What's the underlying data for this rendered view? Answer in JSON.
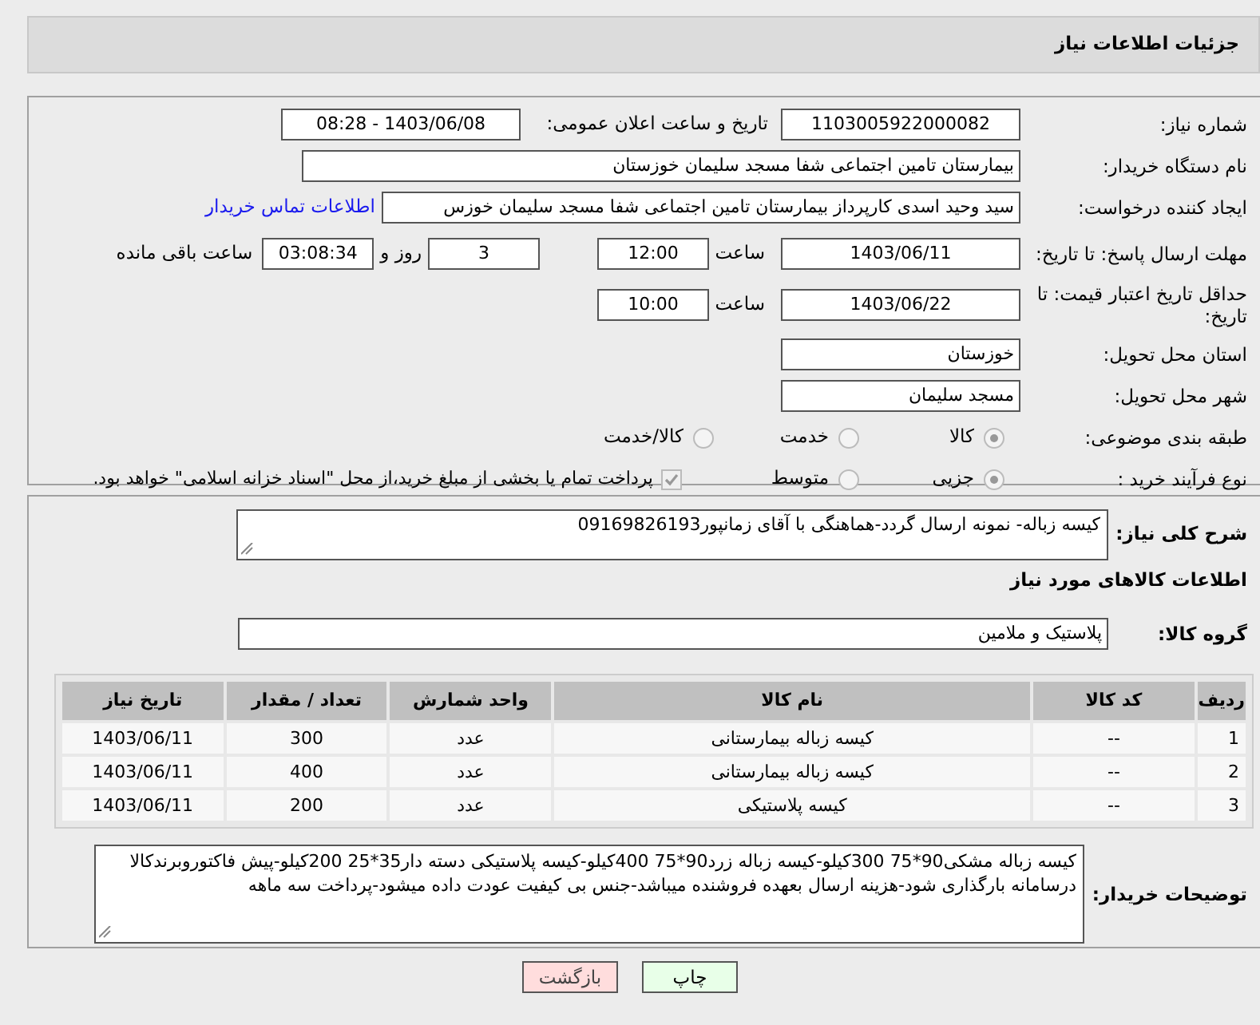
{
  "header": {
    "title": "جزئیات اطلاعات نیاز"
  },
  "need_number": {
    "label": "شماره نیاز:",
    "value": "1103005922000082"
  },
  "announce": {
    "label": "تاریخ و ساعت اعلان عمومی:",
    "value": "1403/06/08 - 08:28"
  },
  "buyer_org": {
    "label": "نام دستگاه خریدار:",
    "value": "بیمارستان تامین اجتماعی شفا مسجد سلیمان خوزستان"
  },
  "requester": {
    "label": "ایجاد کننده درخواست:",
    "value": "سید وحید اسدی کارپرداز بیمارستان تامین اجتماعی شفا مسجد سلیمان خوزس",
    "link": "اطلاعات تماس خریدار"
  },
  "reply_deadline": {
    "label": "مهلت ارسال پاسخ: تا تاریخ:",
    "date": "1403/06/11",
    "time_label": "ساعت",
    "time": "12:00",
    "days": "3",
    "days_label": "روز و",
    "remaining": "03:08:34",
    "remaining_label": "ساعت باقی مانده"
  },
  "price_validity": {
    "label": "حداقل تاریخ اعتبار قیمت: تا تاریخ:",
    "date": "1403/06/22",
    "time_label": "ساعت",
    "time": "10:00"
  },
  "province": {
    "label": "استان محل تحویل:",
    "value": "خوزستان"
  },
  "city": {
    "label": "شهر محل تحویل:",
    "value": "مسجد سلیمان"
  },
  "category": {
    "label": "طبقه بندی موضوعی:",
    "options": [
      {
        "label": "کالا",
        "selected": true
      },
      {
        "label": "خدمت",
        "selected": false
      },
      {
        "label": "کالا/خدمت",
        "selected": false
      }
    ]
  },
  "process": {
    "label": "نوع فرآیند خرید :",
    "options": [
      {
        "label": "جزیی",
        "selected": true
      },
      {
        "label": "متوسط",
        "selected": false
      }
    ],
    "checkbox": {
      "label": "پرداخت تمام یا بخشی از مبلغ خرید،از محل \"اسناد خزانه اسلامی\" خواهد بود.",
      "checked": true
    }
  },
  "description": {
    "label": "شرح کلی نیاز:",
    "value": "کیسه زباله- نمونه ارسال گردد-هماهنگی با آقای زمانپور09169826193"
  },
  "goods": {
    "title": "اطلاعات کالاهای مورد نیاز",
    "group_label": "گروه کالا:",
    "group_value": "پلاستیک و ملامین",
    "columns": [
      "ردیف",
      "کد کالا",
      "نام کالا",
      "واحد شمارش",
      "تعداد / مقدار",
      "تاریخ نیاز"
    ],
    "rows": [
      [
        "1",
        "--",
        "کیسه زباله بیمارستانی",
        "عدد",
        "300",
        "1403/06/11"
      ],
      [
        "2",
        "--",
        "کیسه زباله بیمارستانی",
        "عدد",
        "400",
        "1403/06/11"
      ],
      [
        "3",
        "--",
        "کیسه پلاستیکی",
        "عدد",
        "200",
        "1403/06/11"
      ]
    ]
  },
  "buyer_notes": {
    "label": "توضیحات خریدار:",
    "value": "کیسه زباله مشکی90*75 300کیلو-کیسه زباله زرد90*75 400کیلو-کیسه پلاستیکی دسته دار35*25 200کیلو-پیش فاکتوروبرندکالا درسامانه بارگذاری شود-هزینه ارسال بعهده فروشنده میباشد-جنس بی کیفیت عودت داده میشود-پرداخت سه ماهه"
  },
  "buttons": [
    {
      "label": "چاپ",
      "kind": "print"
    },
    {
      "label": "بازگشت",
      "kind": "back"
    }
  ]
}
